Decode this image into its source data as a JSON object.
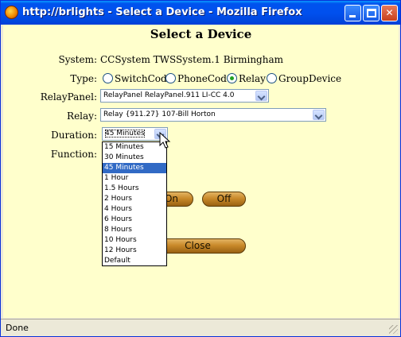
{
  "window": {
    "title": "http://brlights - Select a Device - Mozilla Firefox",
    "controls": {
      "minimize": "minimize-icon",
      "maximize": "maximize-icon",
      "close": "close-icon"
    }
  },
  "page": {
    "heading": "Select a Device",
    "system": {
      "label": "System:",
      "value": "CCSystem TWSSystem.1 Birmingham"
    },
    "type": {
      "label": "Type:",
      "options": [
        "SwitchCode",
        "PhoneCode",
        "Relay",
        "GroupDevice"
      ],
      "selected": "Relay"
    },
    "relay_panel": {
      "label": "RelayPanel:",
      "value": "RelayPanel RelayPanel.911 LI-CC 4.0"
    },
    "relay": {
      "label": "Relay:",
      "value": "Relay {911.27} 107-Bill Horton"
    },
    "duration": {
      "label": "Duration:",
      "value": "45 Minutes",
      "options": [
        "15 Minutes",
        "30 Minutes",
        "45 Minutes",
        "1 Hour",
        "1.5 Hours",
        "2 Hours",
        "4 Hours",
        "6 Hours",
        "8 Hours",
        "10 Hours",
        "12 Hours",
        "Default"
      ],
      "highlighted": "45 Minutes"
    },
    "function": {
      "label": "Function:"
    },
    "buttons": {
      "on": "On",
      "off": "Off",
      "close": "Close"
    }
  },
  "status": {
    "text": "Done"
  },
  "colors": {
    "page_bg": "#ffffcc",
    "titlebar": "#0050ee",
    "highlight": "#316ac5",
    "button": "#c98a2a"
  }
}
